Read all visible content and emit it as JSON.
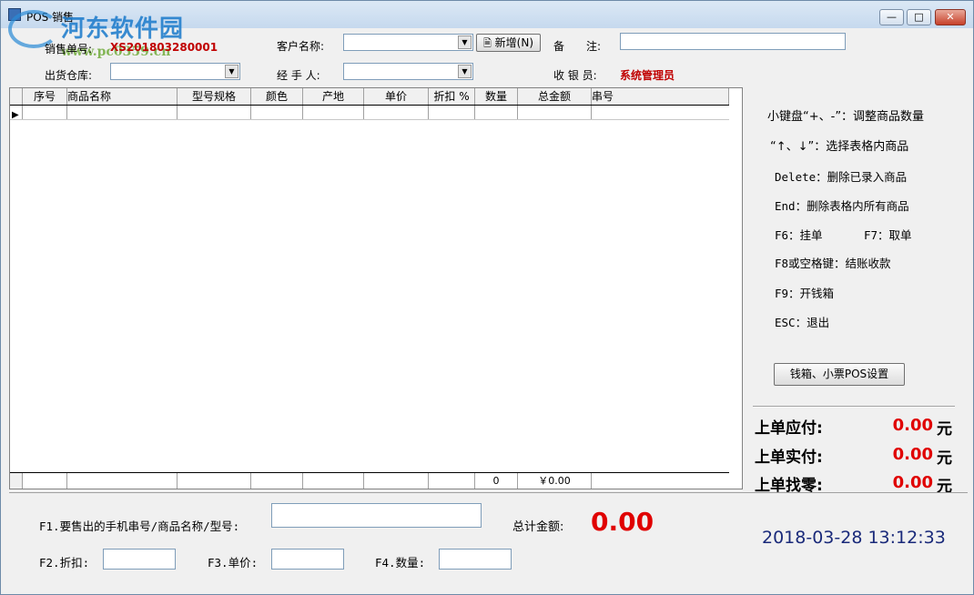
{
  "window": {
    "title": "POS 销售",
    "watermark_text": "河东软件园",
    "watermark_url": "www.pc0359.cn"
  },
  "header": {
    "sale_no_label": "销售单号:",
    "sale_no_value": "XS201803280001",
    "customer_label": "客户名称:",
    "customer_value": "",
    "new_button": "新增(N)",
    "remark_label": "备　　注:",
    "remark_value": "",
    "warehouse_label": "出货仓库:",
    "warehouse_value": "",
    "handler_label": "经 手 人:",
    "handler_value": "",
    "cashier_label": "收 银 员:",
    "cashier_value": "系统管理员"
  },
  "grid": {
    "columns": [
      "序号",
      "商品名称",
      "型号规格",
      "颜色",
      "产地",
      "单价",
      "折扣 %",
      "数量",
      "总金额",
      "串号"
    ],
    "footer": {
      "qty": "0",
      "total": "￥0.00"
    }
  },
  "hints": [
    "小键盘“+、-”：调整商品数量",
    "“↑、↓”：选择表格内商品",
    "Delete：删除已录入商品",
    "End：删除表格内所有商品",
    "F6：挂单",
    "F7：取单",
    "F8或空格键：结账收款",
    "F9：开钱箱",
    "ESC：退出"
  ],
  "settings_button": "钱箱、小票POS设置",
  "last_order": {
    "payable_label": "上单应付:",
    "payable_value": "0.00",
    "paid_label": "上单实付:",
    "paid_value": "0.00",
    "change_label": "上单找零:",
    "change_value": "0.00",
    "unit": "元"
  },
  "bottom": {
    "f1_label": "F1.要售出的手机串号/商品名称/型号:",
    "f1_value": "",
    "total_label": "总计金额:",
    "total_value": "0.00",
    "f2_label": "F2.折扣:",
    "f2_value": "",
    "f3_label": "F3.单价:",
    "f3_value": "",
    "f4_label": "F4.数量:",
    "f4_value": "",
    "datetime": "2018-03-28 13:12:33"
  },
  "colors": {
    "accent_red": "#e00000",
    "label_red": "#c00000",
    "datetime_blue": "#1a2a7a"
  }
}
